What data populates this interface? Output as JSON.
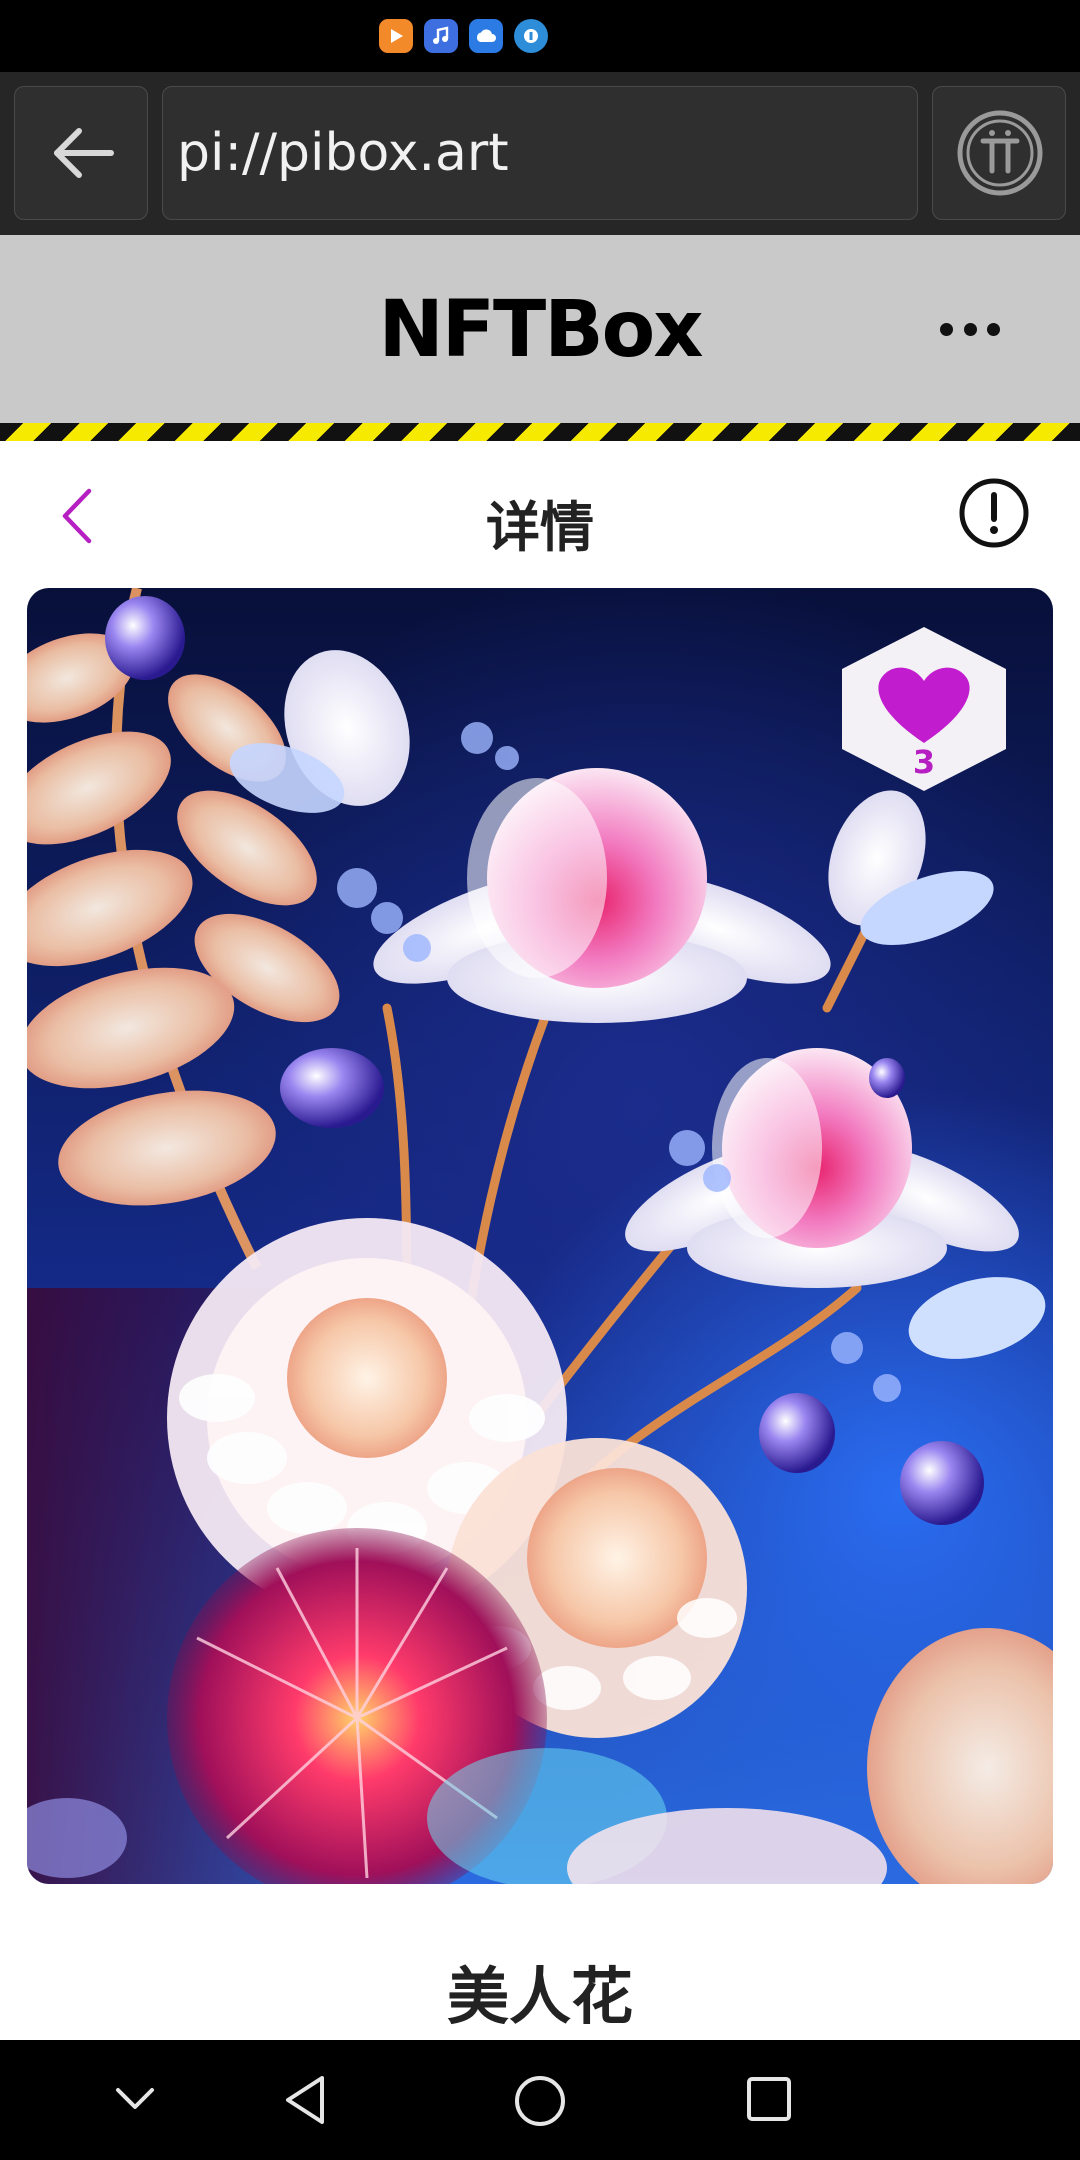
{
  "browser": {
    "url": "pi://pibox.art"
  },
  "app": {
    "title": "NFTBox"
  },
  "detail": {
    "title": "详情"
  },
  "artwork": {
    "like_count": "3"
  },
  "nft": {
    "name": "美人花"
  },
  "icons": {
    "back": "back-arrow-icon",
    "pi": "pi-logo-icon",
    "more": "more-dots-icon",
    "chevron": "chevron-left-icon",
    "info": "info-circle-icon",
    "heart": "heart-icon"
  },
  "colors": {
    "accent": "#b61fc2",
    "header_bg": "#c9c9c9",
    "stripe_yellow": "#f6ea00"
  }
}
